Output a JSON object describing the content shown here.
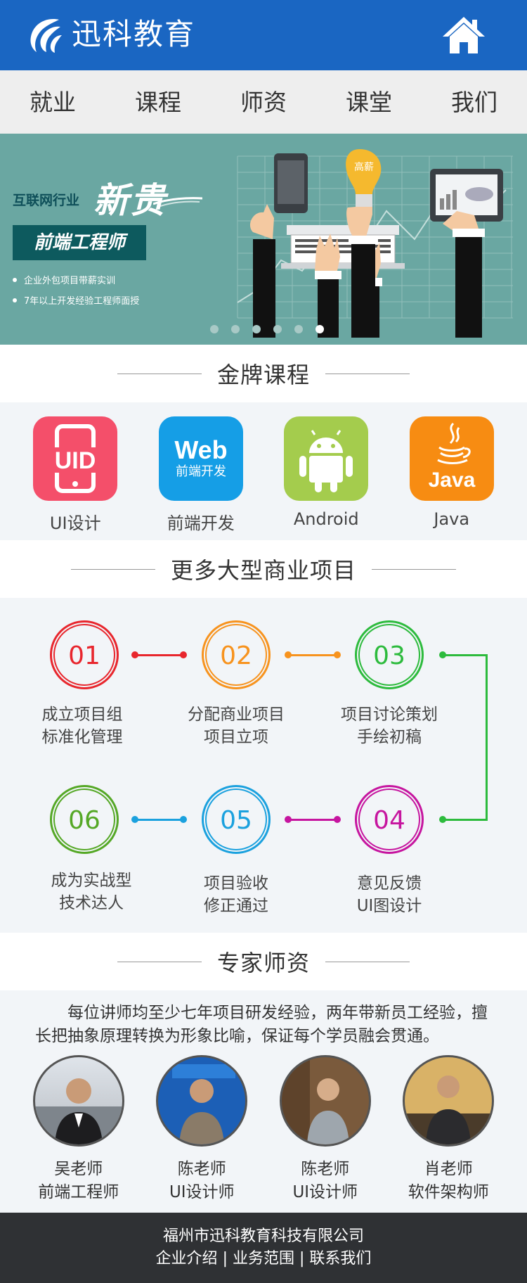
{
  "header": {
    "brand": "迅科教育",
    "home_icon": "home-icon",
    "bg_color": "#1a66c2"
  },
  "nav": {
    "items": [
      "就业",
      "课程",
      "师资",
      "课堂",
      "我们"
    ]
  },
  "banner": {
    "industry": "互联网行业",
    "headline": "新贵",
    "role": "前端工程师",
    "bullets": [
      "企业外包项目带薪实训",
      "7年以上开发经验工程师面授"
    ],
    "bulb_text": "高薪",
    "slide_count": 6,
    "active_slide": 6
  },
  "courses_section": {
    "title": "金牌课程",
    "items": [
      {
        "label": "UI设计",
        "icon": "uid-phone-icon",
        "icon_text": "UID",
        "color": "#f44f6a"
      },
      {
        "label": "前端开发",
        "icon": "web-icon",
        "icon_text": "Web",
        "icon_sub": "前端开发",
        "color": "#159ee6"
      },
      {
        "label": "Android",
        "icon": "android-icon",
        "color": "#a4cc4d"
      },
      {
        "label": "Java",
        "icon": "java-icon",
        "icon_text": "Java",
        "color": "#f78c12"
      }
    ]
  },
  "projects_section": {
    "title": "更多大型商业项目",
    "steps": [
      {
        "num": "01",
        "line1": "成立项目组",
        "line2": "标准化管理",
        "color": "#e8262d"
      },
      {
        "num": "02",
        "line1": "分配商业项目",
        "line2": "项目立项",
        "color": "#f7931e"
      },
      {
        "num": "03",
        "line1": "项目讨论策划",
        "line2": "手绘初稿",
        "color": "#2dbb3d"
      },
      {
        "num": "04",
        "line1": "意见反馈",
        "line2": "UI图设计",
        "color": "#c6159f"
      },
      {
        "num": "05",
        "line1": "项目验收",
        "line2": "修正通过",
        "color": "#1ba1de"
      },
      {
        "num": "06",
        "line1": "成为实战型",
        "line2": "技术达人",
        "color": "#55a826"
      }
    ]
  },
  "teachers_section": {
    "title": "专家师资",
    "intro": "每位讲师均至少七年项目研发经验，两年带新员工经验，擅长把抽象原理转换为形象比喻，保证每个学员融会贯通。",
    "teachers": [
      {
        "name": "吴老师",
        "role": "前端工程师"
      },
      {
        "name": "陈老师",
        "role": "UI设计师"
      },
      {
        "name": "陈老师",
        "role": "UI设计师"
      },
      {
        "name": "肖老师",
        "role": "软件架构师"
      }
    ]
  },
  "footer": {
    "company": "福州市迅科教育科技有限公司",
    "links": [
      "企业介绍",
      "业务范围",
      "联系我们"
    ],
    "separator": "|"
  }
}
